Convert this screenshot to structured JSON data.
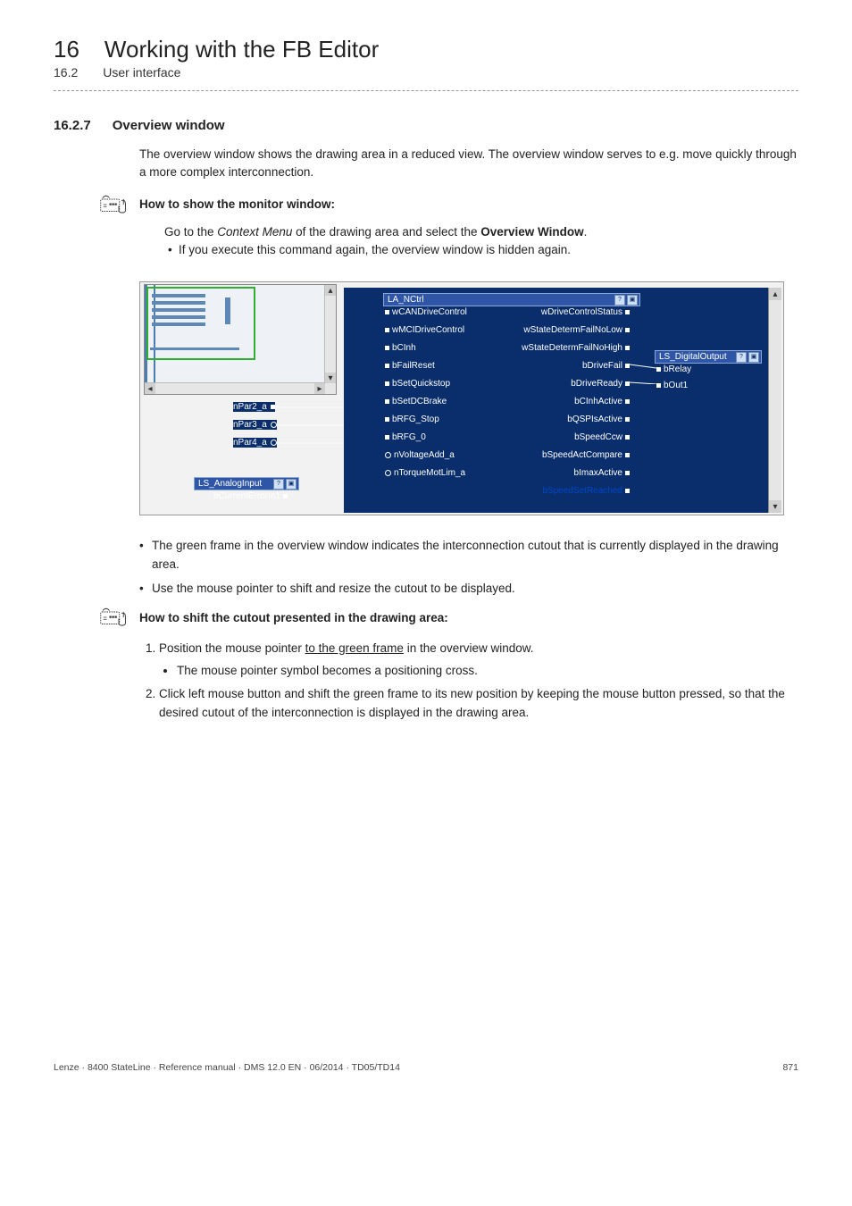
{
  "header": {
    "chapter_num": "16",
    "chapter_title": "Working with the FB Editor",
    "sub_num": "16.2",
    "sub_title": "User interface"
  },
  "section": {
    "num": "16.2.7",
    "title": "Overview window"
  },
  "intro": "The overview window shows the drawing area in a reduced view. The overview window serves to e.g. move quickly through a more complex interconnection.",
  "howto1": {
    "label": "How to show the monitor window:",
    "step": "Go to the ",
    "step_em": "Context Menu",
    "step_mid": " of the drawing area and select the ",
    "step_bold": "Overview Window",
    "step_end": ".",
    "sub": "If you execute this command again, the overview window is hidden again."
  },
  "after_bullets": {
    "b1": "The green frame in the overview window indicates the interconnection cutout that is currently displayed in the drawing area.",
    "b2": "Use the mouse pointer to shift and resize the cutout to be displayed."
  },
  "howto2": {
    "label": "How to shift the cutout presented in the drawing area:",
    "step1_pre": "Position the mouse pointer ",
    "step1_u": "to the green frame",
    "step1_post": " in the overview window.",
    "step1_sub": "The mouse pointer symbol becomes a positioning cross.",
    "step2": "Click left mouse button and shift the green frame to its new position by keeping the mouse button pressed, so that the desired cutout of the interconnection is displayed in the drawing area."
  },
  "screenshot": {
    "la_nctrl": "LA_NCtrl",
    "ls_digital": "LS_DigitalOutput",
    "ls_analog": "LS_AnalogInput",
    "bCurrentErrorIn1": "bCurrentErrorIn1",
    "left_params": [
      "nPar2_a",
      "nPar3_a",
      "nPar4_a"
    ],
    "left_ports": [
      "wCANDriveControl",
      "wMCIDriveControl",
      "bCInh",
      "bFailReset",
      "bSetQuickstop",
      "bSetDCBrake",
      "bRFG_Stop",
      "bRFG_0",
      "nVoltageAdd_a",
      "nTorqueMotLim_a"
    ],
    "right_ports": [
      "wDriveControlStatus",
      "wStateDetermFailNoLow",
      "wStateDetermFailNoHigh",
      "bDriveFail",
      "bDriveReady",
      "bCInhActive",
      "bQSPIsActive",
      "bSpeedCcw",
      "bSpeedActCompare",
      "bImaxActive",
      "bSpeedSetReached"
    ],
    "digital_ports": [
      "bRelay",
      "bOut1"
    ]
  },
  "footer": {
    "left": "Lenze · 8400 StateLine · Reference manual · DMS 12.0 EN · 06/2014 · TD05/TD14",
    "right": "871"
  }
}
